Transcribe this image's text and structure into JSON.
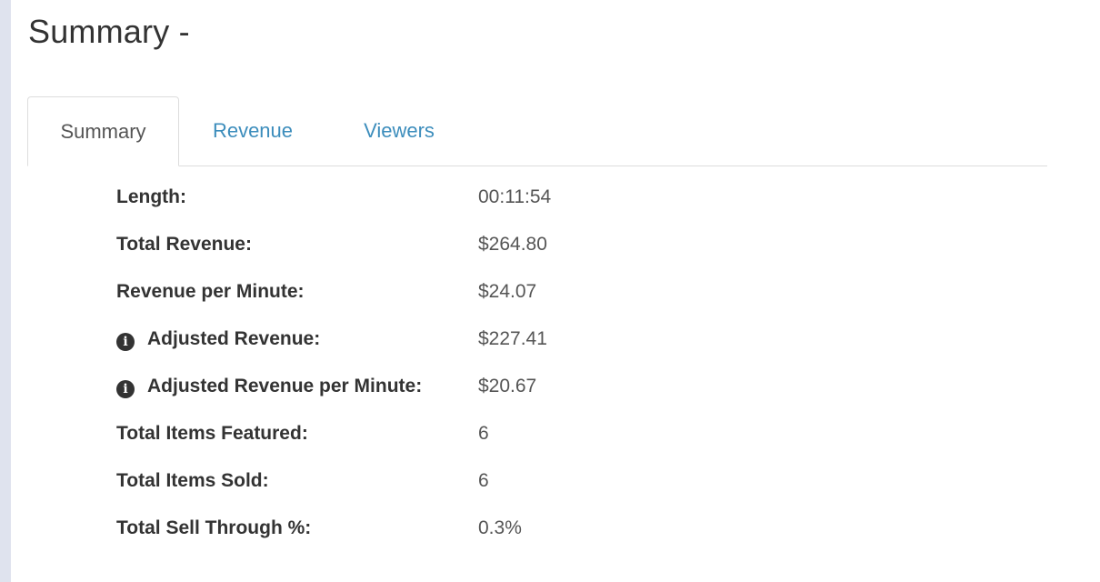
{
  "page": {
    "title": "Summary -"
  },
  "tabs": [
    {
      "label": "Summary",
      "active": true
    },
    {
      "label": "Revenue",
      "active": false
    },
    {
      "label": "Viewers",
      "active": false
    }
  ],
  "colors": {
    "link": "#3c8dbc",
    "text": "#333333",
    "muted": "#555555",
    "border": "#dddddd",
    "sidebar_edge": "#dfe3ee"
  },
  "summary": {
    "rows": [
      {
        "label": "Length:",
        "value": "00:11:54",
        "info_icon": false
      },
      {
        "label": "Total Revenue:",
        "value": "$264.80",
        "info_icon": false
      },
      {
        "label": "Revenue per Minute:",
        "value": "$24.07",
        "info_icon": false
      },
      {
        "label": "Adjusted Revenue:",
        "value": "$227.41",
        "info_icon": true
      },
      {
        "label": "Adjusted Revenue per Minute:",
        "value": "$20.67",
        "info_icon": true
      },
      {
        "label": "Total Items Featured:",
        "value": "6",
        "info_icon": false
      },
      {
        "label": "Total Items Sold:",
        "value": "6",
        "info_icon": false
      },
      {
        "label": "Total Sell Through %:",
        "value": "0.3%",
        "info_icon": false
      }
    ]
  },
  "icons": {
    "info": "info-circle-icon"
  }
}
